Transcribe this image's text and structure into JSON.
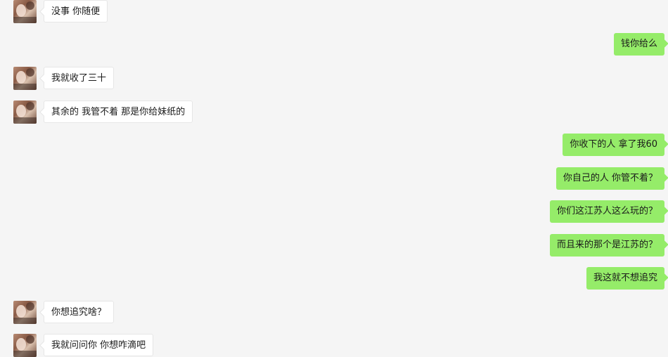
{
  "messages": [
    {
      "side": "in",
      "text": "没事 你随便"
    },
    {
      "side": "out",
      "text": "钱你给么"
    },
    {
      "side": "in",
      "text": "我就收了三十"
    },
    {
      "side": "in",
      "text": "其余的  我管不着  那是你给妹纸的"
    },
    {
      "side": "out",
      "text": "你收下的人 拿了我60"
    },
    {
      "side": "out",
      "text": "你自己的人 你管不着？"
    },
    {
      "side": "out",
      "text": "你们这江苏人这么玩的？"
    },
    {
      "side": "out",
      "text": "而且来的那个是江苏的？"
    },
    {
      "side": "out",
      "text": "我这就不想追究"
    },
    {
      "side": "in",
      "text": "你想追究啥？"
    },
    {
      "side": "in",
      "text": "我就问问你  你想咋滴吧"
    }
  ],
  "colors": {
    "outgoing_bubble": "#95ec69",
    "incoming_bubble": "#ffffff",
    "background": "#f5f5f5"
  }
}
